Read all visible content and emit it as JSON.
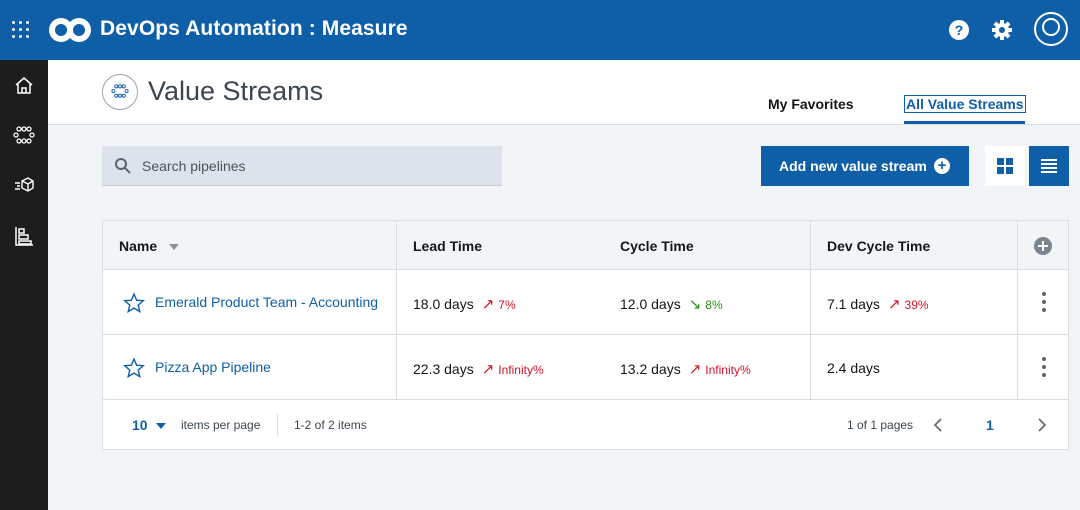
{
  "app": {
    "title": "DevOps Automation : Measure"
  },
  "header": {
    "page_title": "Value Streams",
    "tabs": [
      {
        "label": "My Favorites",
        "active": false
      },
      {
        "label": "All Value Streams",
        "active": true
      }
    ]
  },
  "search": {
    "placeholder": "Search pipelines",
    "value": ""
  },
  "toolbar": {
    "add_label": "Add new value stream"
  },
  "table": {
    "columns": [
      "Name",
      "Lead Time",
      "Cycle Time",
      "Dev Cycle Time"
    ],
    "rows": [
      {
        "name": "Emerald Product Team - Accounting",
        "lead_time": "18.0 days",
        "lead_delta": "7%",
        "lead_trend": "up",
        "cycle_time": "12.0 days",
        "cycle_delta": "8%",
        "cycle_trend": "down",
        "dev_cycle_time": "7.1 days",
        "dev_delta": "39%",
        "dev_trend": "up"
      },
      {
        "name": "Pizza App Pipeline",
        "lead_time": "22.3 days",
        "lead_delta": "Infinity%",
        "lead_trend": "up",
        "cycle_time": "13.2 days",
        "cycle_delta": "Infinity%",
        "cycle_trend": "up",
        "dev_cycle_time": "2.4 days",
        "dev_delta": "",
        "dev_trend": ""
      }
    ]
  },
  "pagination": {
    "page_size": "10",
    "items_per_page_label": "items per page",
    "range_label": "1-2 of 2 items",
    "pages_label": "1 of 1 pages",
    "current_page": "1"
  },
  "colors": {
    "brand": "#0f5fa8",
    "nav": "#1d1d1d",
    "increase": "#d3142a",
    "decrease": "#2d8a1f"
  },
  "icons": [
    "apps-grid-icon",
    "infinity-logo-icon",
    "help-icon",
    "gear-icon",
    "user-avatar-icon",
    "home-icon",
    "value-streams-icon",
    "deploy-icon",
    "reports-icon",
    "search-icon",
    "add-circle-icon",
    "grid-view-icon",
    "list-view-icon",
    "star-icon",
    "kebab-menu-icon",
    "sort-down-icon",
    "chevron-left-icon",
    "chevron-right-icon",
    "arrow-up-right-icon",
    "arrow-down-right-icon"
  ]
}
